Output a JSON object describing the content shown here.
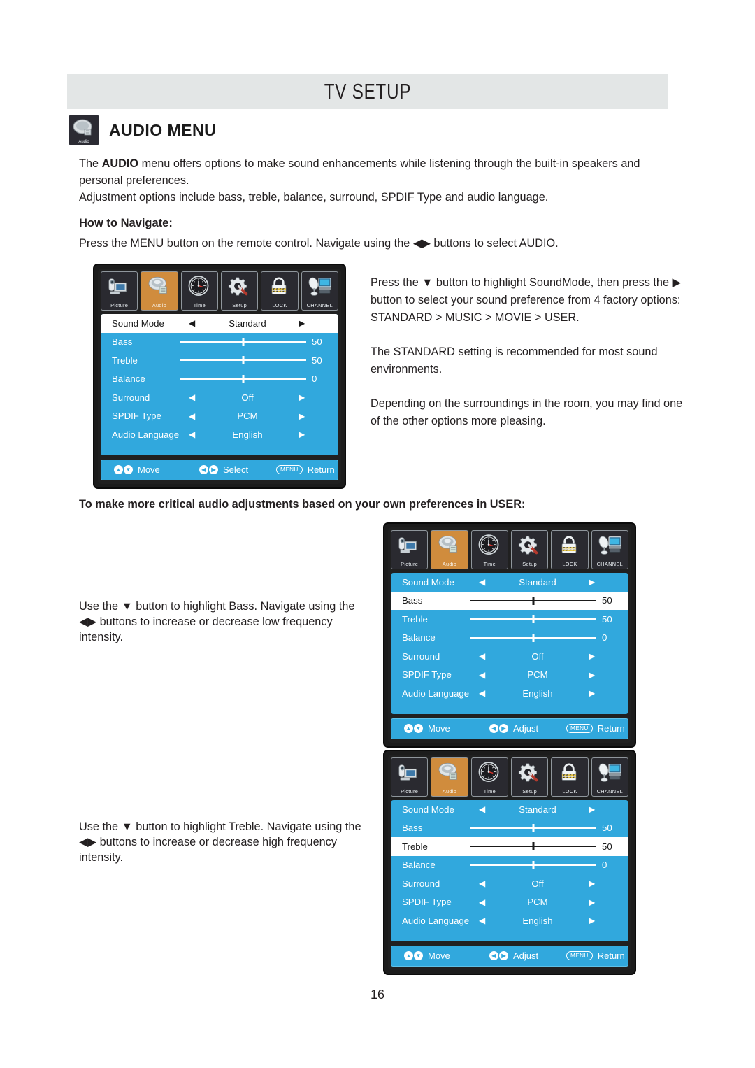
{
  "header": {
    "title": "TV SETUP"
  },
  "section": {
    "icon": "audio-menu-icon",
    "title": "AUDIO MENU"
  },
  "intro": {
    "line1_pre": "The ",
    "line1_bold": "AUDIO",
    "line1_post": " menu offers options to make sound enhancements while listening through the built-in speakers and personal preferences.",
    "line2": "Adjustment options include bass, treble, balance, surround, SPDIF Type and audio language."
  },
  "navigate": {
    "label": "How to Navigate:",
    "text": "Press the MENU button on the remote control. Navigate using the ◀▶ buttons to select AUDIO."
  },
  "right_column": {
    "p1": "Press the ▼ button to highlight SoundMode, then press the ▶ button to select your sound preference from 4 factory options: STANDARD > MUSIC > MOVIE > USER.",
    "p2": "The STANDARD setting is recommended for most sound environments.",
    "p3": "Depending on the surroundings in the room, you may find one of the other options more pleasing."
  },
  "critical_heading": "To make more critical audio adjustments based on your own preferences in USER:",
  "left_notes": {
    "bass": "Use the ▼ button to highlight Bass. Navigate using the ◀▶ buttons to increase or decrease low frequency intensity.",
    "treble": "Use the ▼ button to highlight Treble. Navigate using the ◀▶ buttons to increase or decrease high frequency intensity."
  },
  "page_number": "16",
  "colors": {
    "osd_blue": "#31a8dd",
    "tab_active_orange": "#d08c3d",
    "header_gray": "#e3e6e6",
    "text": "#231f20"
  },
  "tabs": [
    {
      "label": "Picture",
      "icon": "camcorder-icon",
      "active": false
    },
    {
      "label": "Audio",
      "icon": "speaker-icon",
      "active": true
    },
    {
      "label": "Time",
      "icon": "clock-icon",
      "active": false
    },
    {
      "label": "Setup",
      "icon": "gear-screwdriver-icon",
      "active": false
    },
    {
      "label": "LOCK",
      "icon": "padlock-icon",
      "active": false
    },
    {
      "label": "CHANNEL",
      "icon": "satellite-tv-icon",
      "active": false
    }
  ],
  "menus": [
    {
      "id": "menu-sound-mode",
      "selected_row": 0,
      "rows": [
        {
          "label": "Sound Mode",
          "type": "option",
          "value": "Standard"
        },
        {
          "label": "Bass",
          "type": "slider",
          "value": "50",
          "pos": 50
        },
        {
          "label": "Treble",
          "type": "slider",
          "value": "50",
          "pos": 50
        },
        {
          "label": "Balance",
          "type": "slider",
          "value": "0",
          "pos": 50
        },
        {
          "label": "Surround",
          "type": "option",
          "value": "Off"
        },
        {
          "label": "SPDIF Type",
          "type": "option",
          "value": "PCM"
        },
        {
          "label": "Audio Language",
          "type": "option",
          "value": "English"
        }
      ],
      "footer": {
        "move": "Move",
        "middle": "Select",
        "menu_key": "MENU",
        "return": "Return"
      }
    },
    {
      "id": "menu-bass",
      "selected_row": 1,
      "rows": [
        {
          "label": "Sound Mode",
          "type": "option",
          "value": "Standard"
        },
        {
          "label": "Bass",
          "type": "slider",
          "value": "50",
          "pos": 50
        },
        {
          "label": "Treble",
          "type": "slider",
          "value": "50",
          "pos": 50
        },
        {
          "label": "Balance",
          "type": "slider",
          "value": "0",
          "pos": 50
        },
        {
          "label": "Surround",
          "type": "option",
          "value": "Off"
        },
        {
          "label": "SPDIF Type",
          "type": "option",
          "value": "PCM"
        },
        {
          "label": "Audio Language",
          "type": "option",
          "value": "English"
        }
      ],
      "footer": {
        "move": "Move",
        "middle": "Adjust",
        "menu_key": "MENU",
        "return": "Return"
      }
    },
    {
      "id": "menu-treble",
      "selected_row": 2,
      "rows": [
        {
          "label": "Sound Mode",
          "type": "option",
          "value": "Standard"
        },
        {
          "label": "Bass",
          "type": "slider",
          "value": "50",
          "pos": 50
        },
        {
          "label": "Treble",
          "type": "slider",
          "value": "50",
          "pos": 50
        },
        {
          "label": "Balance",
          "type": "slider",
          "value": "0",
          "pos": 50
        },
        {
          "label": "Surround",
          "type": "option",
          "value": "Off"
        },
        {
          "label": "SPDIF Type",
          "type": "option",
          "value": "PCM"
        },
        {
          "label": "Audio Language",
          "type": "option",
          "value": "English"
        }
      ],
      "footer": {
        "move": "Move",
        "middle": "Adjust",
        "menu_key": "MENU",
        "return": "Return"
      }
    }
  ],
  "glyphs": {
    "arrow_left": "◀",
    "arrow_right": "▶",
    "up": "▲",
    "down": "▼"
  }
}
